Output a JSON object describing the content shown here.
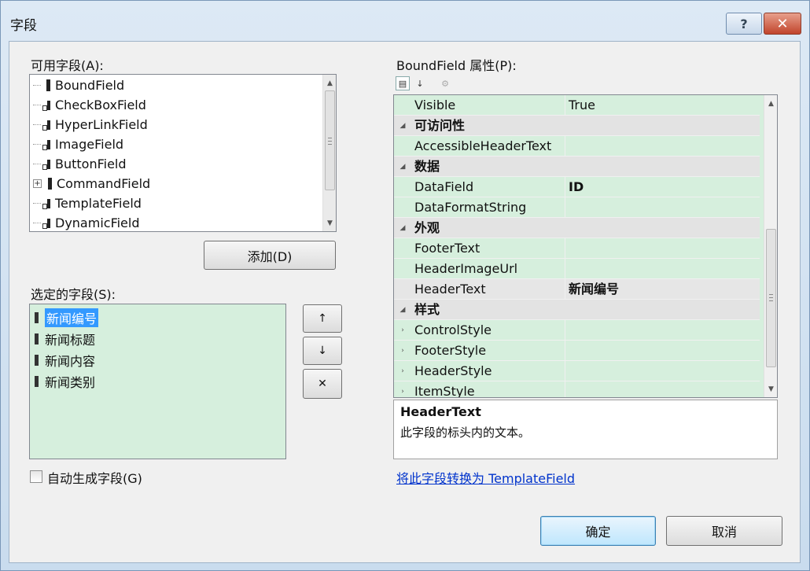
{
  "window": {
    "title": "字段",
    "help_label": "?",
    "close_label": "✕"
  },
  "available": {
    "label": "可用字段(A):",
    "items": [
      {
        "label": "BoundField"
      },
      {
        "label": "CheckBoxField"
      },
      {
        "label": "HyperLinkField"
      },
      {
        "label": "ImageField"
      },
      {
        "label": "ButtonField"
      },
      {
        "label": "CommandField"
      },
      {
        "label": "TemplateField"
      },
      {
        "label": "DynamicField"
      }
    ],
    "add_button": "添加(D)"
  },
  "selected": {
    "label": "选定的字段(S):",
    "items": [
      "新闻编号",
      "新闻标题",
      "新闻内容",
      "新闻类别"
    ],
    "selected_index": 0,
    "move_up": "↑",
    "move_down": "↓",
    "remove": "✕"
  },
  "auto_generate": {
    "label": "自动生成字段(G)",
    "checked": false
  },
  "properties": {
    "label": "BoundField 属性(P):",
    "rows": [
      {
        "kind": "prop",
        "name": "Visible",
        "value": "True",
        "bold": false
      },
      {
        "kind": "cat",
        "name": "可访问性"
      },
      {
        "kind": "prop",
        "name": "AccessibleHeaderText",
        "value": "",
        "bold": false
      },
      {
        "kind": "cat",
        "name": "数据"
      },
      {
        "kind": "prop",
        "name": "DataField",
        "value": "ID",
        "bold": true
      },
      {
        "kind": "prop",
        "name": "DataFormatString",
        "value": "",
        "bold": false
      },
      {
        "kind": "cat",
        "name": "外观"
      },
      {
        "kind": "prop",
        "name": "FooterText",
        "value": "",
        "bold": false
      },
      {
        "kind": "prop",
        "name": "HeaderImageUrl",
        "value": "",
        "bold": false
      },
      {
        "kind": "prop",
        "name": "HeaderText",
        "value": "新闻编号",
        "bold": true,
        "selected": true
      },
      {
        "kind": "cat",
        "name": "样式"
      },
      {
        "kind": "sub",
        "name": "ControlStyle",
        "value": ""
      },
      {
        "kind": "sub",
        "name": "FooterStyle",
        "value": ""
      },
      {
        "kind": "sub",
        "name": "HeaderStyle",
        "value": ""
      },
      {
        "kind": "sub",
        "name": "ItemStyle",
        "value": ""
      }
    ],
    "description_title": "HeaderText",
    "description_text": "此字段的标头内的文本。"
  },
  "convert_link": "将此字段转换为 TemplateField",
  "footer": {
    "ok": "确定",
    "cancel": "取消"
  }
}
